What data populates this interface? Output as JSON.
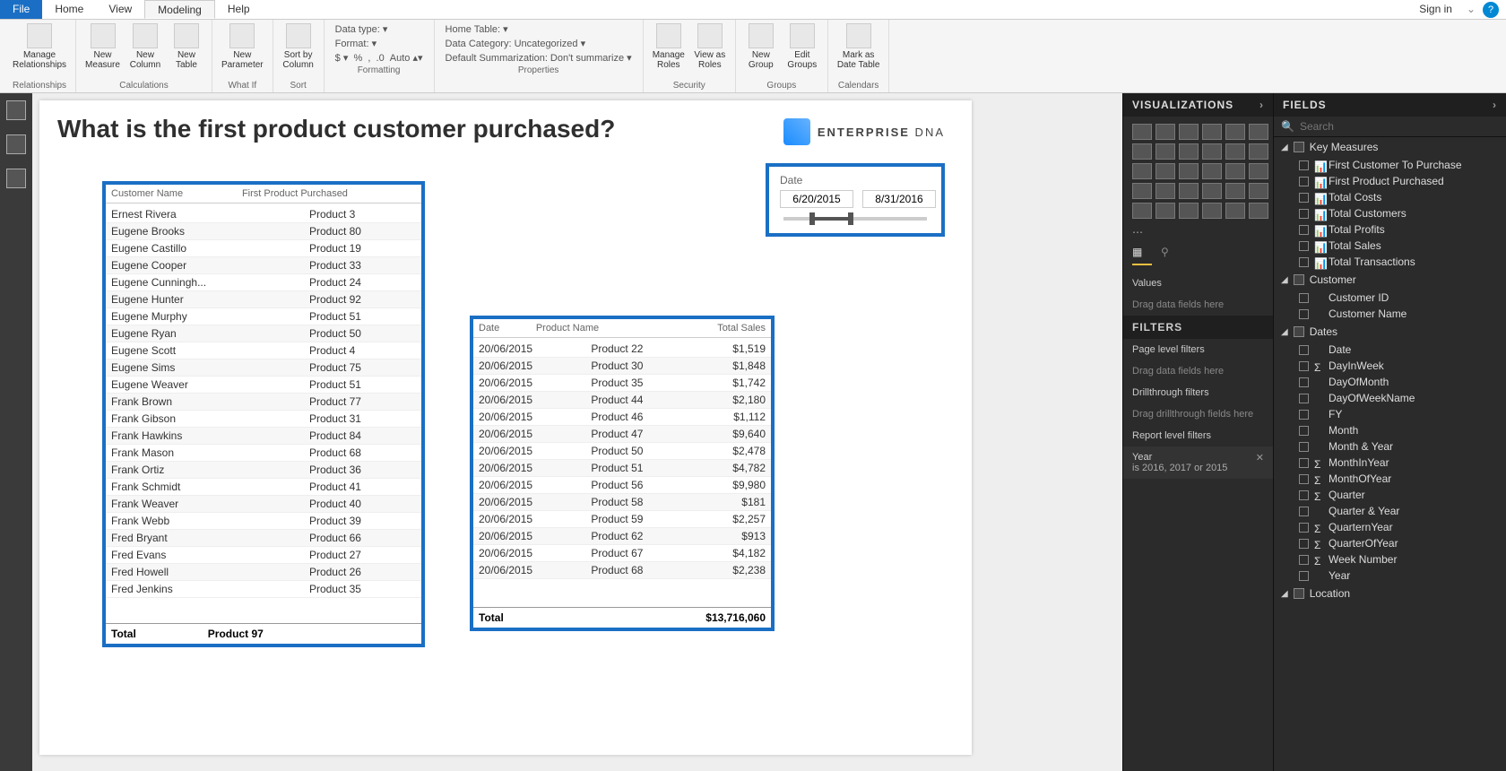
{
  "menu": {
    "file": "File",
    "home": "Home",
    "view": "View",
    "modeling": "Modeling",
    "help": "Help",
    "signin": "Sign in"
  },
  "ribbon": {
    "relationships": {
      "manage": "Manage\nRelationships",
      "group": "Relationships"
    },
    "calc": {
      "measure": "New\nMeasure",
      "column": "New\nColumn",
      "table": "New\nTable",
      "group": "Calculations"
    },
    "whatif": {
      "param": "New\nParameter",
      "group": "What If"
    },
    "sort": {
      "sort": "Sort by\nColumn",
      "group": "Sort"
    },
    "formatting": {
      "datatype": "Data type:  ▾",
      "format": "Format:  ▾",
      "auto": "Auto",
      "group": "Formatting"
    },
    "properties": {
      "home": "Home Table:  ▾",
      "cat": "Data Category: Uncategorized ▾",
      "summ": "Default Summarization: Don't summarize ▾",
      "group": "Properties"
    },
    "security": {
      "manage": "Manage\nRoles",
      "view": "View as\nRoles",
      "group": "Security"
    },
    "groups": {
      "new": "New\nGroup",
      "edit": "Edit\nGroups",
      "group": "Groups"
    },
    "calendars": {
      "mark": "Mark as\nDate Table",
      "group": "Calendars"
    }
  },
  "page": {
    "title": "What is the first product customer purchased?",
    "logo": "ENTERPRISE DNA",
    "slicer": {
      "label": "Date",
      "from": "6/20/2015",
      "to": "8/31/2016"
    },
    "table1": {
      "cols": [
        "Customer Name",
        "First Product Purchased"
      ],
      "rows": [
        [
          "Ernest Rivera",
          "Product 3"
        ],
        [
          "Eugene Brooks",
          "Product 80"
        ],
        [
          "Eugene Castillo",
          "Product 19"
        ],
        [
          "Eugene Cooper",
          "Product 33"
        ],
        [
          "Eugene Cunningh...",
          "Product 24"
        ],
        [
          "Eugene Hunter",
          "Product 92"
        ],
        [
          "Eugene Murphy",
          "Product 51"
        ],
        [
          "Eugene Ryan",
          "Product 50"
        ],
        [
          "Eugene Scott",
          "Product 4"
        ],
        [
          "Eugene Sims",
          "Product 75"
        ],
        [
          "Eugene Weaver",
          "Product 51"
        ],
        [
          "Frank Brown",
          "Product 77"
        ],
        [
          "Frank Gibson",
          "Product 31"
        ],
        [
          "Frank Hawkins",
          "Product 84"
        ],
        [
          "Frank Mason",
          "Product 68"
        ],
        [
          "Frank Ortiz",
          "Product 36"
        ],
        [
          "Frank Schmidt",
          "Product 41"
        ],
        [
          "Frank Weaver",
          "Product 40"
        ],
        [
          "Frank Webb",
          "Product 39"
        ],
        [
          "Fred Bryant",
          "Product 66"
        ],
        [
          "Fred Evans",
          "Product 27"
        ],
        [
          "Fred Howell",
          "Product 26"
        ],
        [
          "Fred Jenkins",
          "Product 35"
        ]
      ],
      "foot": [
        "Total",
        "Product 97"
      ]
    },
    "table2": {
      "cols": [
        "Date",
        "Product Name",
        "Total Sales"
      ],
      "rows": [
        [
          "20/06/2015",
          "Product 22",
          "$1,519"
        ],
        [
          "20/06/2015",
          "Product 30",
          "$1,848"
        ],
        [
          "20/06/2015",
          "Product 35",
          "$1,742"
        ],
        [
          "20/06/2015",
          "Product 44",
          "$2,180"
        ],
        [
          "20/06/2015",
          "Product 46",
          "$1,112"
        ],
        [
          "20/06/2015",
          "Product 47",
          "$9,640"
        ],
        [
          "20/06/2015",
          "Product 50",
          "$2,478"
        ],
        [
          "20/06/2015",
          "Product 51",
          "$4,782"
        ],
        [
          "20/06/2015",
          "Product 56",
          "$9,980"
        ],
        [
          "20/06/2015",
          "Product 58",
          "$181"
        ],
        [
          "20/06/2015",
          "Product 59",
          "$2,257"
        ],
        [
          "20/06/2015",
          "Product 62",
          "$913"
        ],
        [
          "20/06/2015",
          "Product 67",
          "$4,182"
        ],
        [
          "20/06/2015",
          "Product 68",
          "$2,238"
        ]
      ],
      "foot": [
        "Total",
        "",
        "$13,716,060"
      ]
    }
  },
  "viz": {
    "title": "VISUALIZATIONS",
    "values": "Values",
    "dragvals": "Drag data fields here",
    "filters": "FILTERS",
    "pagefilters": "Page level filters",
    "dragpage": "Drag data fields here",
    "drill": "Drillthrough filters",
    "dragdrill": "Drag drillthrough fields here",
    "report": "Report level filters",
    "yearlabel": "Year",
    "yearval": "is 2016, 2017 or 2015"
  },
  "fields": {
    "title": "FIELDS",
    "search": "Search",
    "groups": [
      {
        "name": "Key Measures",
        "items": [
          {
            "t": "m",
            "n": "First Customer To Purchase"
          },
          {
            "t": "m",
            "n": "First Product Purchased"
          },
          {
            "t": "m",
            "n": "Total Costs"
          },
          {
            "t": "m",
            "n": "Total Customers"
          },
          {
            "t": "m",
            "n": "Total Profits"
          },
          {
            "t": "m",
            "n": "Total Sales"
          },
          {
            "t": "m",
            "n": "Total Transactions"
          }
        ]
      },
      {
        "name": "Customer",
        "items": [
          {
            "t": "c",
            "n": "Customer ID"
          },
          {
            "t": "c",
            "n": "Customer Name"
          }
        ]
      },
      {
        "name": "Dates",
        "items": [
          {
            "t": "c",
            "n": "Date"
          },
          {
            "t": "s",
            "n": "DayInWeek"
          },
          {
            "t": "c",
            "n": "DayOfMonth"
          },
          {
            "t": "c",
            "n": "DayOfWeekName"
          },
          {
            "t": "c",
            "n": "FY"
          },
          {
            "t": "c",
            "n": "Month"
          },
          {
            "t": "c",
            "n": "Month & Year"
          },
          {
            "t": "s",
            "n": "MonthInYear"
          },
          {
            "t": "s",
            "n": "MonthOfYear"
          },
          {
            "t": "s",
            "n": "Quarter"
          },
          {
            "t": "c",
            "n": "Quarter & Year"
          },
          {
            "t": "s",
            "n": "QuarternYear"
          },
          {
            "t": "s",
            "n": "QuarterOfYear"
          },
          {
            "t": "s",
            "n": "Week Number"
          },
          {
            "t": "c",
            "n": "Year"
          }
        ]
      },
      {
        "name": "Location",
        "items": []
      }
    ]
  }
}
